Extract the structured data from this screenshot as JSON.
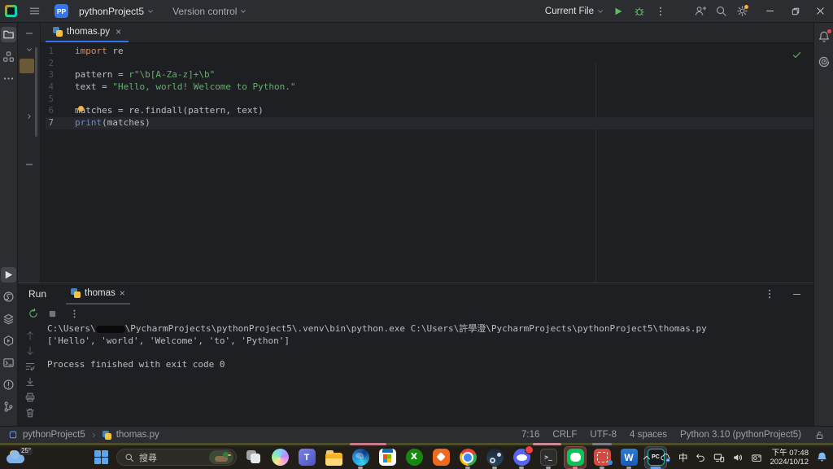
{
  "titlebar": {
    "badge": "PP",
    "project": "pythonProject5",
    "vcs": "Version control",
    "run_config": "Current File",
    "icons": [
      "pycharm-logo",
      "main-menu",
      "run",
      "debug",
      "more",
      "add-user",
      "search",
      "settings",
      "minimize",
      "restore",
      "close"
    ]
  },
  "activity_bar": {
    "top": [
      {
        "name": "project-folder",
        "icon": "folder",
        "selected": true
      },
      {
        "name": "structure",
        "icon": "commit",
        "selected": false
      },
      {
        "name": "more-tools",
        "icon": "moreh",
        "selected": false
      }
    ],
    "bottom": [
      {
        "name": "run-tool",
        "icon": "play",
        "selected": true
      },
      {
        "name": "python-packages",
        "icon": "pypkg",
        "selected": false
      },
      {
        "name": "services",
        "icon": "layers",
        "selected": false
      },
      {
        "name": "python-console",
        "icon": "pyconsole",
        "selected": false
      },
      {
        "name": "terminal",
        "icon": "terminal",
        "selected": false
      },
      {
        "name": "problems",
        "icon": "problem",
        "selected": false
      },
      {
        "name": "version-control-tool",
        "icon": "branch",
        "selected": false
      }
    ]
  },
  "editor": {
    "tab": "thomas.py",
    "lines": [
      {
        "num": "1",
        "segs": [
          [
            "kw",
            "import"
          ],
          [
            "pl",
            " re"
          ]
        ]
      },
      {
        "num": "2",
        "segs": []
      },
      {
        "num": "3",
        "segs": [
          [
            "pl",
            "pattern = "
          ],
          [
            "str",
            "r\"\\b[A-Za-z]+\\b\""
          ]
        ]
      },
      {
        "num": "4",
        "segs": [
          [
            "pl",
            "text = "
          ],
          [
            "str",
            "\"Hello, world! Welcome to Python.\""
          ]
        ]
      },
      {
        "num": "5",
        "segs": []
      },
      {
        "num": "6",
        "segs": [
          [
            "pl",
            "matches = re.findall(pattern, text)"
          ]
        ],
        "bulb": true
      },
      {
        "num": "7",
        "segs": [
          [
            "fn",
            "print"
          ],
          [
            "pl",
            "(matches)"
          ]
        ],
        "current": true
      }
    ],
    "colors": {
      "keyword": "#cf8e6d",
      "string": "#6aab73",
      "builtin": "#6e8cc8",
      "plain": "#bcbec4",
      "accent": "#3574f0"
    }
  },
  "run_panel": {
    "title": "Run",
    "tab": "thomas",
    "side_toolbar": [
      {
        "name": "scroll-up",
        "icon": "arrup",
        "dim": true
      },
      {
        "name": "scroll-down",
        "icon": "arrdown",
        "dim": true
      },
      {
        "name": "soft-wrap",
        "icon": "softwrap",
        "dim": false
      },
      {
        "name": "scroll-to-end",
        "icon": "scrollend",
        "dim": false
      },
      {
        "name": "print",
        "icon": "printer",
        "dim": false
      },
      {
        "name": "clear-all",
        "icon": "trash",
        "dim": false
      }
    ],
    "console": [
      {
        "parts": [
          [
            "t",
            "C:\\Users\\"
          ],
          [
            "redact",
            ""
          ],
          [
            "t",
            "\\PycharmProjects\\pythonProject5\\.venv\\bin\\python.exe C:\\Users\\許學澄\\PycharmProjects\\pythonProject5\\thomas.py"
          ]
        ]
      },
      {
        "parts": [
          [
            "t",
            "['Hello', 'world', 'Welcome', 'to', 'Python']"
          ]
        ]
      },
      {
        "parts": []
      },
      {
        "parts": [
          [
            "t",
            "Process finished with exit code 0"
          ]
        ]
      }
    ]
  },
  "status_bar": {
    "breadcrumb": [
      "pythonProject5",
      "thomas.py"
    ],
    "right": [
      "7:16",
      "CRLF",
      "UTF-8",
      "4 spaces",
      "Python 3.10 (pythonProject5)"
    ]
  },
  "taskbar": {
    "weather_temp": "25°",
    "search_placeholder": "搜尋",
    "apps": [
      {
        "name": "task-view"
      },
      {
        "name": "copilot"
      },
      {
        "name": "teams"
      },
      {
        "name": "file-explorer"
      },
      {
        "name": "edge",
        "dot": true
      },
      {
        "name": "store"
      },
      {
        "name": "xbox"
      },
      {
        "name": "hexagon-app"
      },
      {
        "name": "chrome",
        "dot": true
      },
      {
        "name": "steam",
        "dot": true
      },
      {
        "name": "discord",
        "dot": true,
        "badge": true
      },
      {
        "name": "terminal-app",
        "dot": true
      },
      {
        "name": "line-app",
        "dot": true,
        "pink": true,
        "selected": true
      },
      {
        "name": "snip-app",
        "dot": true
      },
      {
        "name": "word",
        "dot": true
      },
      {
        "name": "pycharm",
        "active": true
      }
    ],
    "tray": [
      {
        "name": "hidden-icons",
        "icon": "chevup"
      },
      {
        "name": "onedrive",
        "icon": "cloudsync"
      },
      {
        "name": "ime",
        "text": "中"
      },
      {
        "name": "pen-input",
        "icon": "undoarr"
      },
      {
        "name": "phone-link",
        "icon": "monitorphone"
      },
      {
        "name": "volume",
        "icon": "volume"
      },
      {
        "name": "camera",
        "icon": "camfolder"
      }
    ],
    "clock": {
      "time": "下午 07:48",
      "date": "2024/10/12"
    }
  }
}
